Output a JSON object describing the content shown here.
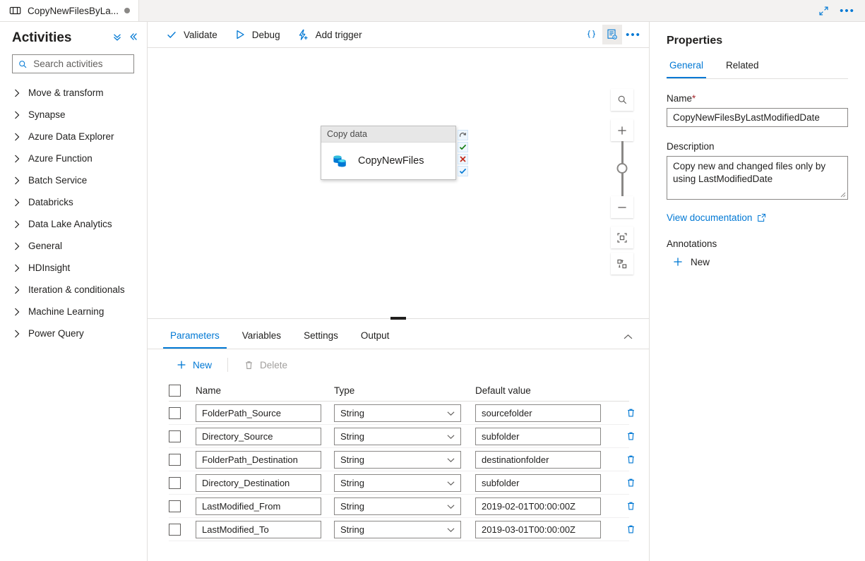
{
  "tab": {
    "title": "CopyNewFilesByLa...",
    "icon": "pipeline-icon",
    "modified_indicator": "unsaved-dot"
  },
  "header": {
    "expand_icon": "expand-diagonal-icon",
    "more_icon": "ellipsis-icon"
  },
  "sidebar": {
    "title": "Activities",
    "collapse_all_icon": "double-chevron-down-icon",
    "collapse_panel_icon": "double-chevron-left-icon",
    "search": {
      "placeholder": "Search activities",
      "value": "",
      "icon": "search-icon"
    },
    "items": [
      {
        "label": "Move & transform"
      },
      {
        "label": "Synapse"
      },
      {
        "label": "Azure Data Explorer"
      },
      {
        "label": "Azure Function"
      },
      {
        "label": "Batch Service"
      },
      {
        "label": "Databricks"
      },
      {
        "label": "Data Lake Analytics"
      },
      {
        "label": "General"
      },
      {
        "label": "HDInsight"
      },
      {
        "label": "Iteration & conditionals"
      },
      {
        "label": "Machine Learning"
      },
      {
        "label": "Power Query"
      }
    ]
  },
  "toolbar": {
    "validate_label": "Validate",
    "debug_label": "Debug",
    "add_trigger_label": "Add trigger",
    "code_icon": "curly-braces-icon",
    "properties_icon": "properties-panel-icon",
    "more_icon": "ellipsis-icon"
  },
  "canvas": {
    "node": {
      "header": "Copy data",
      "name": "CopyNewFiles",
      "icon": "copy-data-icon",
      "status_icons": [
        {
          "name": "retry-icon",
          "glyph": "↷",
          "color": "#5a5a5a"
        },
        {
          "name": "success-check-icon",
          "glyph": "✔",
          "color": "#107c10"
        },
        {
          "name": "failure-x-icon",
          "glyph": "✖",
          "color": "#c42b1c"
        },
        {
          "name": "completion-check-icon",
          "glyph": "✔",
          "color": "#0078d4"
        }
      ]
    },
    "zoom_controls": {
      "search_icon": "zoom-search-icon",
      "zoom_in_icon": "zoom-in-icon",
      "zoom_out_icon": "zoom-out-icon",
      "fit_icon": "fit-to-screen-icon",
      "arrange_icon": "auto-arrange-icon"
    }
  },
  "bottom_panel": {
    "tabs": [
      {
        "label": "Parameters",
        "active": true
      },
      {
        "label": "Variables",
        "active": false
      },
      {
        "label": "Settings",
        "active": false
      },
      {
        "label": "Output",
        "active": false
      }
    ],
    "collapse_icon": "chevron-up-icon",
    "commands": {
      "new_label": "New",
      "new_icon": "plus-icon",
      "delete_label": "Delete",
      "delete_icon": "trash-icon"
    },
    "table": {
      "columns": [
        "Name",
        "Type",
        "Default value"
      ],
      "rows": [
        {
          "name": "FolderPath_Source",
          "type": "String",
          "default": "sourcefolder"
        },
        {
          "name": "Directory_Source",
          "type": "String",
          "default": "subfolder"
        },
        {
          "name": "FolderPath_Destination",
          "type": "String",
          "default": "destinationfolder"
        },
        {
          "name": "Directory_Destination",
          "type": "String",
          "default": "subfolder"
        },
        {
          "name": "LastModified_From",
          "type": "String",
          "default": "2019-02-01T00:00:00Z"
        },
        {
          "name": "LastModified_To",
          "type": "String",
          "default": "2019-03-01T00:00:00Z"
        }
      ]
    }
  },
  "properties": {
    "title": "Properties",
    "tabs": [
      {
        "label": "General",
        "active": true
      },
      {
        "label": "Related",
        "active": false
      }
    ],
    "name_label": "Name",
    "name_required": "*",
    "name_value": "CopyNewFilesByLastModifiedDate",
    "description_label": "Description",
    "description_value": "Copy new and changed files only by using LastModifiedDate",
    "doc_link_label": "View documentation",
    "doc_link_icon": "external-link-icon",
    "annotations_label": "Annotations",
    "annotation_new_label": "New",
    "annotation_new_icon": "plus-icon"
  },
  "colors": {
    "accent": "#0078d4",
    "success": "#107c10",
    "error": "#c42b1c",
    "required": "#a4262c"
  }
}
